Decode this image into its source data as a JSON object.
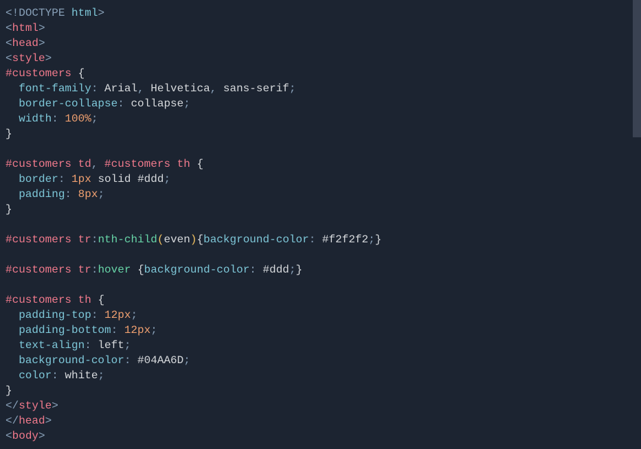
{
  "scrollbar": {
    "visible": true
  },
  "code": {
    "lines": [
      {
        "tokens": [
          {
            "t": "<",
            "c": "ang"
          },
          {
            "t": "!DOCTYPE",
            "c": "doctype"
          },
          {
            "t": " ",
            "c": "pun"
          },
          {
            "t": "html",
            "c": "prop"
          },
          {
            "t": ">",
            "c": "ang"
          }
        ]
      },
      {
        "tokens": [
          {
            "t": "<",
            "c": "ang"
          },
          {
            "t": "html",
            "c": "tag"
          },
          {
            "t": ">",
            "c": "ang"
          }
        ]
      },
      {
        "tokens": [
          {
            "t": "<",
            "c": "ang"
          },
          {
            "t": "head",
            "c": "tag"
          },
          {
            "t": ">",
            "c": "ang"
          }
        ]
      },
      {
        "tokens": [
          {
            "t": "<",
            "c": "ang"
          },
          {
            "t": "style",
            "c": "tag"
          },
          {
            "t": ">",
            "c": "ang"
          }
        ]
      },
      {
        "tokens": [
          {
            "t": "#customers",
            "c": "sel"
          },
          {
            "t": " ",
            "c": "pun"
          },
          {
            "t": "{",
            "c": "val"
          }
        ]
      },
      {
        "tokens": [
          {
            "t": "  ",
            "c": "pun"
          },
          {
            "t": "font-family",
            "c": "prop"
          },
          {
            "t": ": ",
            "c": "pun"
          },
          {
            "t": "Arial",
            "c": "val"
          },
          {
            "t": ", ",
            "c": "comma"
          },
          {
            "t": "Helvetica",
            "c": "val"
          },
          {
            "t": ", ",
            "c": "comma"
          },
          {
            "t": "sans-serif",
            "c": "val"
          },
          {
            "t": ";",
            "c": "pun"
          }
        ]
      },
      {
        "tokens": [
          {
            "t": "  ",
            "c": "pun"
          },
          {
            "t": "border-collapse",
            "c": "prop"
          },
          {
            "t": ": ",
            "c": "pun"
          },
          {
            "t": "collapse",
            "c": "val"
          },
          {
            "t": ";",
            "c": "pun"
          }
        ]
      },
      {
        "tokens": [
          {
            "t": "  ",
            "c": "pun"
          },
          {
            "t": "width",
            "c": "prop"
          },
          {
            "t": ": ",
            "c": "pun"
          },
          {
            "t": "100%",
            "c": "num"
          },
          {
            "t": ";",
            "c": "pun"
          }
        ]
      },
      {
        "tokens": [
          {
            "t": "}",
            "c": "val"
          }
        ]
      },
      {
        "tokens": [
          {
            "t": "",
            "c": "pun"
          }
        ]
      },
      {
        "tokens": [
          {
            "t": "#customers",
            "c": "sel"
          },
          {
            "t": " ",
            "c": "pun"
          },
          {
            "t": "td",
            "c": "sel"
          },
          {
            "t": ", ",
            "c": "comma"
          },
          {
            "t": "#customers",
            "c": "sel"
          },
          {
            "t": " ",
            "c": "pun"
          },
          {
            "t": "th",
            "c": "sel"
          },
          {
            "t": " ",
            "c": "pun"
          },
          {
            "t": "{",
            "c": "val"
          }
        ]
      },
      {
        "tokens": [
          {
            "t": "  ",
            "c": "pun"
          },
          {
            "t": "border",
            "c": "prop"
          },
          {
            "t": ": ",
            "c": "pun"
          },
          {
            "t": "1px",
            "c": "num"
          },
          {
            "t": " ",
            "c": "pun"
          },
          {
            "t": "solid",
            "c": "val"
          },
          {
            "t": " ",
            "c": "pun"
          },
          {
            "t": "#ddd",
            "c": "color"
          },
          {
            "t": ";",
            "c": "pun"
          }
        ]
      },
      {
        "tokens": [
          {
            "t": "  ",
            "c": "pun"
          },
          {
            "t": "padding",
            "c": "prop"
          },
          {
            "t": ": ",
            "c": "pun"
          },
          {
            "t": "8px",
            "c": "num"
          },
          {
            "t": ";",
            "c": "pun"
          }
        ]
      },
      {
        "tokens": [
          {
            "t": "}",
            "c": "val"
          }
        ]
      },
      {
        "tokens": [
          {
            "t": "",
            "c": "pun"
          }
        ]
      },
      {
        "tokens": [
          {
            "t": "#customers",
            "c": "sel"
          },
          {
            "t": " ",
            "c": "pun"
          },
          {
            "t": "tr",
            "c": "sel"
          },
          {
            "t": ":",
            "c": "pun"
          },
          {
            "t": "nth-child",
            "c": "pseudo"
          },
          {
            "t": "(",
            "c": "paren"
          },
          {
            "t": "even",
            "c": "val"
          },
          {
            "t": ")",
            "c": "paren"
          },
          {
            "t": "{",
            "c": "val"
          },
          {
            "t": "background-color",
            "c": "prop"
          },
          {
            "t": ": ",
            "c": "pun"
          },
          {
            "t": "#f2f2f2",
            "c": "color"
          },
          {
            "t": ";",
            "c": "pun"
          },
          {
            "t": "}",
            "c": "val"
          }
        ]
      },
      {
        "tokens": [
          {
            "t": "",
            "c": "pun"
          }
        ]
      },
      {
        "tokens": [
          {
            "t": "#customers",
            "c": "sel"
          },
          {
            "t": " ",
            "c": "pun"
          },
          {
            "t": "tr",
            "c": "sel"
          },
          {
            "t": ":",
            "c": "pun"
          },
          {
            "t": "hover",
            "c": "pseudo"
          },
          {
            "t": " ",
            "c": "pun"
          },
          {
            "t": "{",
            "c": "val"
          },
          {
            "t": "background-color",
            "c": "prop"
          },
          {
            "t": ": ",
            "c": "pun"
          },
          {
            "t": "#ddd",
            "c": "color"
          },
          {
            "t": ";",
            "c": "pun"
          },
          {
            "t": "}",
            "c": "val"
          }
        ]
      },
      {
        "tokens": [
          {
            "t": "",
            "c": "pun"
          }
        ]
      },
      {
        "tokens": [
          {
            "t": "#customers",
            "c": "sel"
          },
          {
            "t": " ",
            "c": "pun"
          },
          {
            "t": "th",
            "c": "sel"
          },
          {
            "t": " ",
            "c": "pun"
          },
          {
            "t": "{",
            "c": "val"
          }
        ]
      },
      {
        "tokens": [
          {
            "t": "  ",
            "c": "pun"
          },
          {
            "t": "padding-top",
            "c": "prop"
          },
          {
            "t": ": ",
            "c": "pun"
          },
          {
            "t": "12px",
            "c": "num"
          },
          {
            "t": ";",
            "c": "pun"
          }
        ]
      },
      {
        "tokens": [
          {
            "t": "  ",
            "c": "pun"
          },
          {
            "t": "padding-bottom",
            "c": "prop"
          },
          {
            "t": ": ",
            "c": "pun"
          },
          {
            "t": "12px",
            "c": "num"
          },
          {
            "t": ";",
            "c": "pun"
          }
        ]
      },
      {
        "tokens": [
          {
            "t": "  ",
            "c": "pun"
          },
          {
            "t": "text-align",
            "c": "prop"
          },
          {
            "t": ": ",
            "c": "pun"
          },
          {
            "t": "left",
            "c": "val"
          },
          {
            "t": ";",
            "c": "pun"
          }
        ]
      },
      {
        "tokens": [
          {
            "t": "  ",
            "c": "pun"
          },
          {
            "t": "background-color",
            "c": "prop"
          },
          {
            "t": ": ",
            "c": "pun"
          },
          {
            "t": "#04AA6D",
            "c": "color"
          },
          {
            "t": ";",
            "c": "pun"
          }
        ]
      },
      {
        "tokens": [
          {
            "t": "  ",
            "c": "pun"
          },
          {
            "t": "color",
            "c": "prop"
          },
          {
            "t": ": ",
            "c": "pun"
          },
          {
            "t": "white",
            "c": "val"
          },
          {
            "t": ";",
            "c": "pun"
          }
        ]
      },
      {
        "tokens": [
          {
            "t": "}",
            "c": "val"
          }
        ]
      },
      {
        "tokens": [
          {
            "t": "</",
            "c": "ang"
          },
          {
            "t": "style",
            "c": "tag"
          },
          {
            "t": ">",
            "c": "ang"
          }
        ]
      },
      {
        "tokens": [
          {
            "t": "</",
            "c": "ang"
          },
          {
            "t": "head",
            "c": "tag"
          },
          {
            "t": ">",
            "c": "ang"
          }
        ]
      },
      {
        "tokens": [
          {
            "t": "<",
            "c": "ang"
          },
          {
            "t": "body",
            "c": "tag"
          },
          {
            "t": ">",
            "c": "ang"
          }
        ]
      }
    ]
  }
}
